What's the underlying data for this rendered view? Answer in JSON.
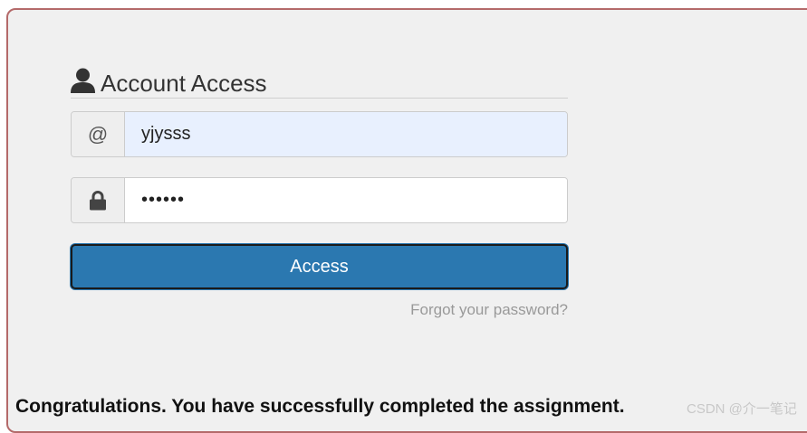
{
  "login": {
    "title": "Account Access",
    "title_icon": "user-icon",
    "username": {
      "icon": "at-sign-icon",
      "icon_glyph": "@",
      "value": "yjysss"
    },
    "password": {
      "icon": "lock-icon",
      "value": "••••••"
    },
    "submit_label": "Access",
    "forgot_link": "Forgot your password?"
  },
  "message": "Congratulations. You have successfully completed the assignment.",
  "watermark": "CSDN @介一笔记",
  "colors": {
    "panel_border": "#b46a6a",
    "panel_background": "#f0f0f0",
    "button": "#2b78b0",
    "autofill": "#e8f0fe"
  }
}
